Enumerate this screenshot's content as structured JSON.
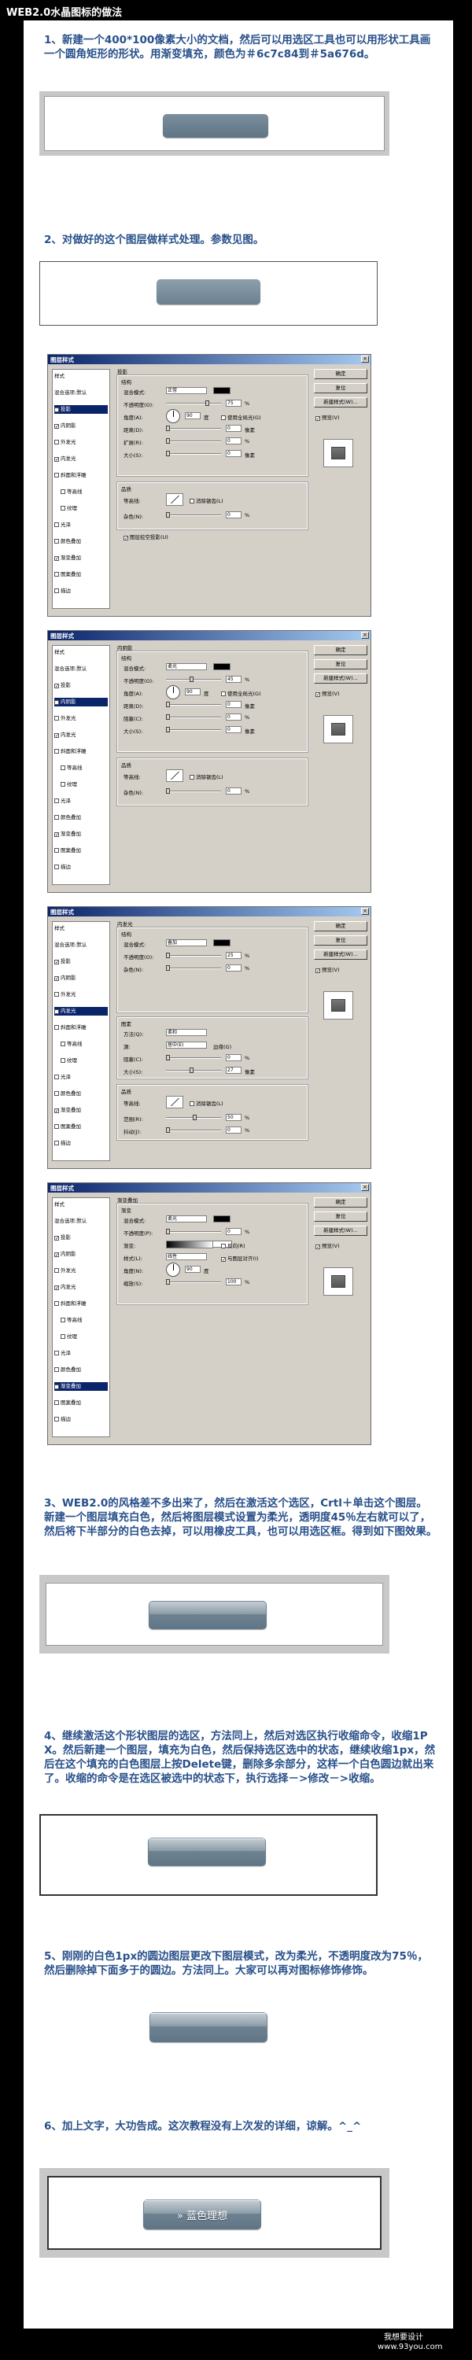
{
  "header": {
    "title": "WEB2.0水晶图标的做法"
  },
  "steps": [
    {
      "text": "1、新建一个400*100像素大小的文档，然后可以用选区工具也可以用形状工具画一个圆角矩形的形状。用渐变填充，颜色为＃6c7c84到＃5a676d。"
    },
    {
      "text": "2、对做好的这个图层做样式处理。参数见图。"
    },
    {
      "text": "3、WEB2.0的风格差不多出来了，然后在激活这个选区，Crtl＋单击这个图层。新建一个图层填充白色，然后将图层模式设置为柔光，透明度45％左右就可以了，然后将下半部分的白色去掉，可以用橡皮工具，也可以用选区框。得到如下图效果。"
    },
    {
      "text": "4、继续激活这个形状图层的选区，方法同上，然后对选区执行收缩命令，收缩1PX。然后新建一个图层，填充为白色，然后保持选区选中的状态，继续收缩1px，然后在这个填充的白色图层上按Delete键，删除多余部分，这样一个白色圆边就出来了。收缩的命令是在选区被选中的状态下，执行选择－>修改－>收缩。"
    },
    {
      "text": "5、刚刚的白色1px的圆边图层更改下图层模式，改为柔光，不透明度改为75％，然后删除掉下面多于的圆边。方法同上。大家可以再对图标修饰修饰。"
    },
    {
      "text": "6、加上文字，大功告成。这次教程没有上次发的详细，谅解。^_^"
    }
  ],
  "final_button": {
    "label": "» 蓝色理想"
  },
  "colors": {
    "gradient_start": "#6c7c84",
    "gradient_end": "#5a676d",
    "step_text": "#28508a"
  },
  "dialog": {
    "title": "图层样式",
    "close": "×",
    "styles_list": [
      "样式",
      "混合选项:默认",
      "投影",
      "内阴影",
      "外发光",
      "内发光",
      "斜面和浮雕",
      "等高线",
      "纹理",
      "光泽",
      "颜色叠加",
      "渐变叠加",
      "图案叠加",
      "描边"
    ],
    "buttons": [
      "确定",
      "复位",
      "新建样式(W)...",
      "预览(V)"
    ],
    "panels": [
      {
        "section": "投影",
        "sub1": "结构",
        "rows": [
          [
            "混合模式:",
            "正常"
          ],
          [
            "不透明度(O):",
            "75",
            "%"
          ],
          [
            "角度(A):",
            "90",
            "度"
          ],
          [
            "距离(D):",
            "0",
            "像素"
          ],
          [
            "扩展(R):",
            "0",
            "%"
          ],
          [
            "大小(S):",
            "0",
            "像素"
          ]
        ],
        "global_light": "使用全局光(G)",
        "sub2": "品质",
        "contour": "等高线:",
        "antialias": "消除锯齿(L)",
        "noise": [
          "杂色(N):",
          "0",
          "%"
        ],
        "extra": "图层挖空投影(U)"
      },
      {
        "section": "内阴影",
        "sub1": "结构",
        "rows": [
          [
            "混合模式:",
            "柔光"
          ],
          [
            "不透明度(O):",
            "45",
            "%"
          ],
          [
            "角度(A):",
            "90",
            "度"
          ],
          [
            "距离(D):",
            "0",
            "像素"
          ],
          [
            "阻塞(C):",
            "0",
            "%"
          ],
          [
            "大小(S):",
            "0",
            "像素"
          ]
        ],
        "global_light": "使用全局光(G)",
        "sub2": "品质",
        "contour": "等高线:",
        "antialias": "消除锯齿(L)",
        "noise": [
          "杂色(N):",
          "0",
          "%"
        ],
        "extra": ""
      },
      {
        "section": "内发光",
        "sub1": "结构",
        "rows": [
          [
            "混合模式:",
            "叠加"
          ],
          [
            "不透明度(O):",
            "25",
            "%"
          ],
          [
            "杂色(N):",
            "0",
            "%"
          ]
        ],
        "sub_elements": "图素",
        "element_rows": [
          [
            "方法(Q):",
            "柔和"
          ],
          [
            "源:",
            "居中(E)"
          ],
          [
            "阻塞(C):",
            "0",
            "%"
          ],
          [
            "大小(S):",
            "27",
            "像素"
          ]
        ],
        "global_light": "边缘(G)",
        "sub2": "品质",
        "contour": "等高线:",
        "antialias": "消除锯齿(L)",
        "noise": [
          "范围(R):",
          "50",
          "%"
        ],
        "jitter": [
          "抖动(J):",
          "0",
          "%"
        ],
        "extra": ""
      },
      {
        "section": "渐变叠加",
        "sub1": "渐变",
        "rows": [
          [
            "混合模式:",
            "柔光"
          ],
          [
            "不透明度(P):",
            "0",
            "%"
          ],
          [
            "渐变:",
            ""
          ],
          [
            "样式(L):",
            "线性"
          ],
          [
            "角度(N):",
            "90",
            "度"
          ],
          [
            "缩放(S):",
            "100",
            "%"
          ]
        ],
        "global_light": "反向(R)",
        "align": "与图层对齐(I)",
        "sub2": "",
        "contour": "",
        "antialias": "",
        "noise": [
          "",
          "",
          ""
        ],
        "extra": ""
      }
    ]
  },
  "footer": {
    "line1": "我想要设计",
    "line2": "www.93you.com"
  }
}
